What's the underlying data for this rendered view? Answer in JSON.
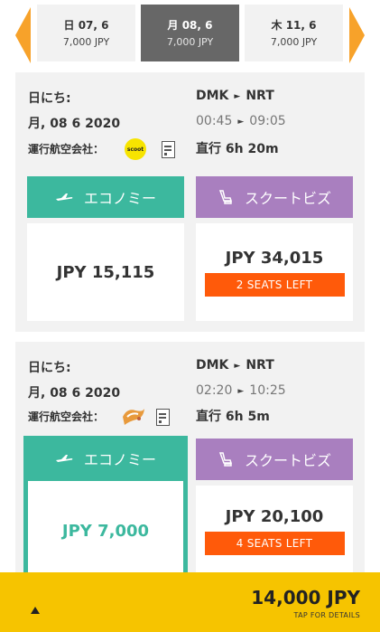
{
  "date_strip": {
    "tabs": [
      {
        "date": "日 07, 6",
        "price": "7,000 JPY",
        "selected": false
      },
      {
        "date": "月 08, 6",
        "price": "7,000 JPY",
        "selected": true
      },
      {
        "date": "木 11, 6",
        "price": "7,000 JPY",
        "selected": false
      }
    ]
  },
  "flights": [
    {
      "date_label": "日にち:",
      "date_value": "月, 08 6 2020",
      "airline_label": "運行航空会社：",
      "airline_logo_text": "scoot",
      "route_from": "DMK",
      "route_to": "NRT",
      "dep_time": "00:45",
      "arr_time": "09:05",
      "duration": "直行 6h 20m",
      "economy": {
        "label": "エコノミー",
        "price": "JPY 15,115"
      },
      "business": {
        "label": "スクートビズ",
        "price": "JPY 34,015",
        "seats": "2 SEATS LEFT"
      }
    },
    {
      "date_label": "日にち:",
      "date_value": "月, 08 6 2020",
      "airline_label": "運行航空会社：",
      "route_from": "DMK",
      "route_to": "NRT",
      "dep_time": "02:20",
      "arr_time": "10:25",
      "duration": "直行 6h 5m",
      "economy": {
        "label": "エコノミー",
        "price": "JPY 7,000",
        "selected": true
      },
      "business": {
        "label": "スクートビズ",
        "price": "JPY 20,100",
        "seats": "4 SEATS LEFT"
      }
    }
  ],
  "summary": {
    "total": "14,000 JPY",
    "tap_hint": "TAP FOR DETAILS"
  },
  "colors": {
    "accent_orange": "#f7a22a",
    "economy_green": "#3cb89e",
    "business_purple": "#a97fbf",
    "seats_orange": "#ff5a0a",
    "summary_yellow": "#f6c400"
  },
  "icons": {
    "nav_prev": "chevron-left-icon",
    "nav_next": "chevron-right-icon",
    "economy": "airplane-icon",
    "business": "seat-icon",
    "fare_rules": "document-icon",
    "expand": "triangle-up-icon"
  }
}
